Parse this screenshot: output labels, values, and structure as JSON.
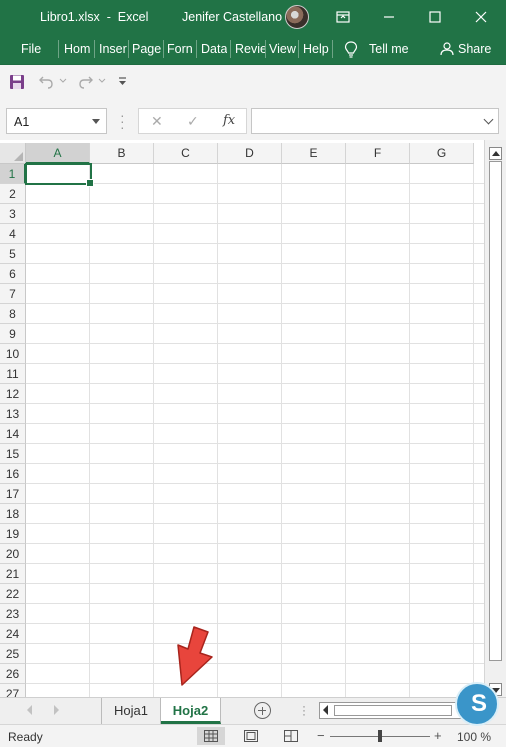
{
  "window": {
    "title": "Libro1.xlsx  -  Excel",
    "user": "Jenifer Castellano"
  },
  "ribbon": {
    "tabs": [
      "File",
      "Hom",
      "Inser",
      "Page",
      "Forn",
      "Data",
      "Revie",
      "View",
      "Help"
    ],
    "tell_me": "Tell me",
    "share": "Share"
  },
  "formula_bar": {
    "name_box": "A1",
    "cancel_symbol": "✕",
    "enter_symbol": "✓",
    "fx_label": "fx",
    "formula": ""
  },
  "sheet": {
    "columns": [
      "A",
      "B",
      "C",
      "D",
      "E",
      "F",
      "G"
    ],
    "rows": [
      "1",
      "2",
      "3",
      "4",
      "5",
      "6",
      "7",
      "8",
      "9",
      "10",
      "11",
      "12",
      "13",
      "14",
      "15",
      "16",
      "17",
      "18",
      "19",
      "20",
      "21",
      "22",
      "23",
      "24",
      "25",
      "26",
      "27"
    ],
    "active_cell": "A1"
  },
  "sheet_tabs": {
    "tabs": [
      "Hoja1",
      "Hoja2"
    ],
    "active": "Hoja2"
  },
  "status_bar": {
    "ready": "Ready",
    "zoom": "100 %"
  },
  "colors": {
    "accent": "#217346",
    "annotation_arrow": "#e8453c"
  }
}
